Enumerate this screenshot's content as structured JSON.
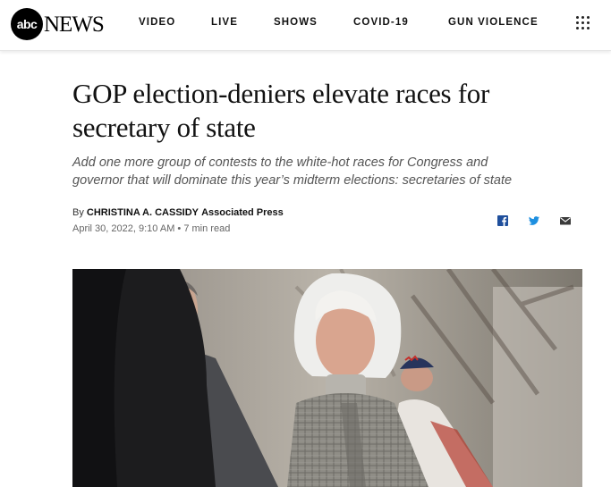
{
  "header": {
    "logo_mark": "abc",
    "logo_word": "NEWS",
    "nav": [
      "VIDEO",
      "LIVE",
      "SHOWS",
      "COVID-19",
      "GUN VIOLENCE"
    ]
  },
  "article": {
    "headline_line1": "GOP election-deniers elevate races for",
    "headline_line2": "secretary of state",
    "dek_line1": "Add one more group of contests to the white-hot races for Congress and",
    "dek_line2": "governor that will dominate this year’s midterm elections: secretaries of state",
    "by_prefix": "By",
    "author": "CHRISTINA A. CASSIDY",
    "source": "Associated Press",
    "date": "April 30, 2022, 9:10 AM",
    "separator": "•",
    "read_time": "7 min read"
  },
  "share": {
    "icons": [
      "facebook-icon",
      "twitter-icon",
      "email-icon"
    ],
    "colors": {
      "facebook": "#1f4f9c",
      "twitter": "#1d8fe0",
      "email": "#3a3a3a"
    }
  }
}
